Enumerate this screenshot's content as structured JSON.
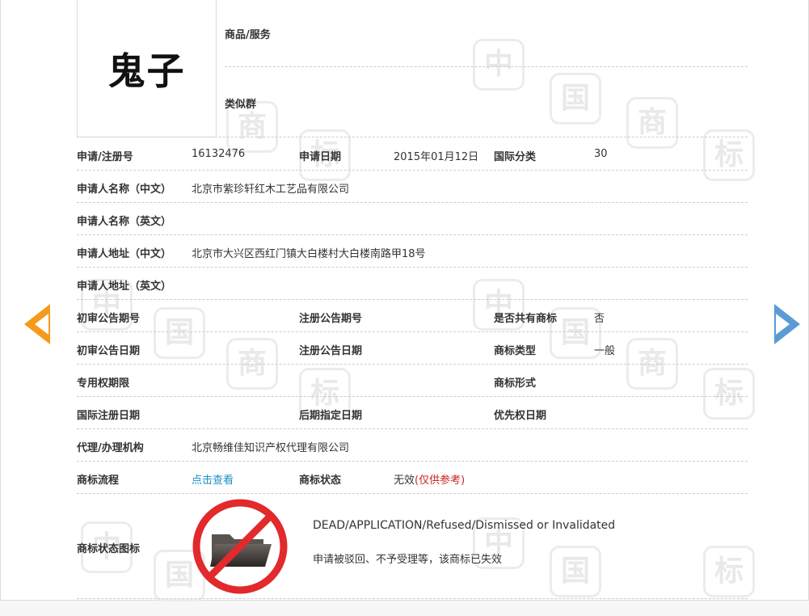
{
  "trademark": {
    "name": "鬼子",
    "goods_services_label": "商品/服务",
    "similar_group_label": "类似群"
  },
  "fields": {
    "reg_no_label": "申请/注册号",
    "reg_no": "16132476",
    "app_date_label": "申请日期",
    "app_date": "2015年01月12日",
    "intl_class_label": "国际分类",
    "intl_class": "30",
    "applicant_cn_label": "申请人名称（中文）",
    "applicant_cn": "北京市紫珍轩红木工艺品有限公司",
    "applicant_en_label": "申请人名称（英文）",
    "applicant_en": "",
    "address_cn_label": "申请人地址（中文）",
    "address_cn": "北京市大兴区西红门镇大白楼村大白楼南路甲18号",
    "address_en_label": "申请人地址（英文）",
    "address_en": "",
    "prelim_pub_no_label": "初审公告期号",
    "prelim_pub_no": "",
    "reg_pub_no_label": "注册公告期号",
    "reg_pub_no": "",
    "shared_label": "是否共有商标",
    "shared": "否",
    "prelim_pub_date_label": "初审公告日期",
    "prelim_pub_date": "",
    "reg_pub_date_label": "注册公告日期",
    "reg_pub_date": "",
    "tm_type_label": "商标类型",
    "tm_type": "一般",
    "exclusive_period_label": "专用权期限",
    "exclusive_period": "",
    "tm_form_label": "商标形式",
    "tm_form": "",
    "intl_reg_date_label": "国际注册日期",
    "intl_reg_date": "",
    "later_designation_label": "后期指定日期",
    "later_designation": "",
    "priority_date_label": "优先权日期",
    "priority_date": "",
    "agent_label": "代理/办理机构",
    "agent": "北京畅维佳知识产权代理有限公司",
    "process_label": "商标流程",
    "process_link": "点击查看",
    "status_label": "商标状态",
    "status_value": "无效",
    "status_ref": "(仅供参考)",
    "status_icon_label": "商标状态图标",
    "status_en": "DEAD/APPLICATION/Refused/Dismissed or Invalidated",
    "status_cn": "申请被驳回、不予受理等，该商标已失效"
  },
  "watermark": {
    "chars": [
      "中",
      "国",
      "商",
      "标"
    ]
  },
  "colors": {
    "prev_arrow": "#f59a1b",
    "next_arrow": "#5b9bd5",
    "link": "#1a8fc4",
    "reference": "#cc2222",
    "prohibition": "#e2292c"
  },
  "icons": {
    "prev": "chevron-left-icon",
    "next": "chevron-right-icon",
    "status": "folder-prohibited-icon"
  }
}
